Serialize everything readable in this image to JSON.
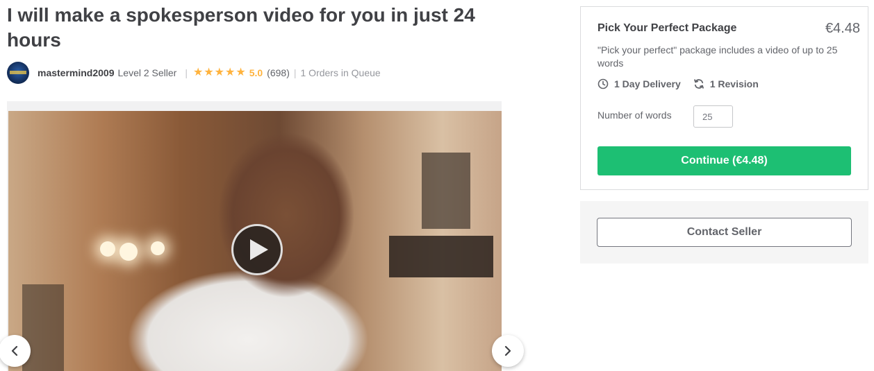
{
  "gig": {
    "title": "I will make a spokesperson video for you in just 24 hours"
  },
  "seller": {
    "name": "mastermind2009",
    "level": "Level 2 Seller",
    "rating": "5.0",
    "stars": 5,
    "review_count": "(698)",
    "queue": "1 Orders in Queue"
  },
  "gallery": {
    "media_type": "video",
    "play_icon": "play-icon",
    "prev_icon": "chevron-left-icon",
    "next_icon": "chevron-right-icon"
  },
  "package": {
    "title": "Pick Your Perfect Package",
    "price": "€4.48",
    "description": "\"Pick your perfect\" package includes a video of up to 25 words",
    "delivery": "1 Day Delivery",
    "delivery_icon": "clock-icon",
    "revisions": "1 Revision",
    "revisions_icon": "refresh-icon",
    "words_label": "Number of words",
    "words_value": "25",
    "continue_label": "Continue (€4.48)"
  },
  "contact": {
    "button_label": "Contact Seller"
  },
  "colors": {
    "accent_green": "#1dbf73",
    "star_yellow": "#ffb33e",
    "text_dark": "#404145",
    "text_muted": "#62646a"
  }
}
